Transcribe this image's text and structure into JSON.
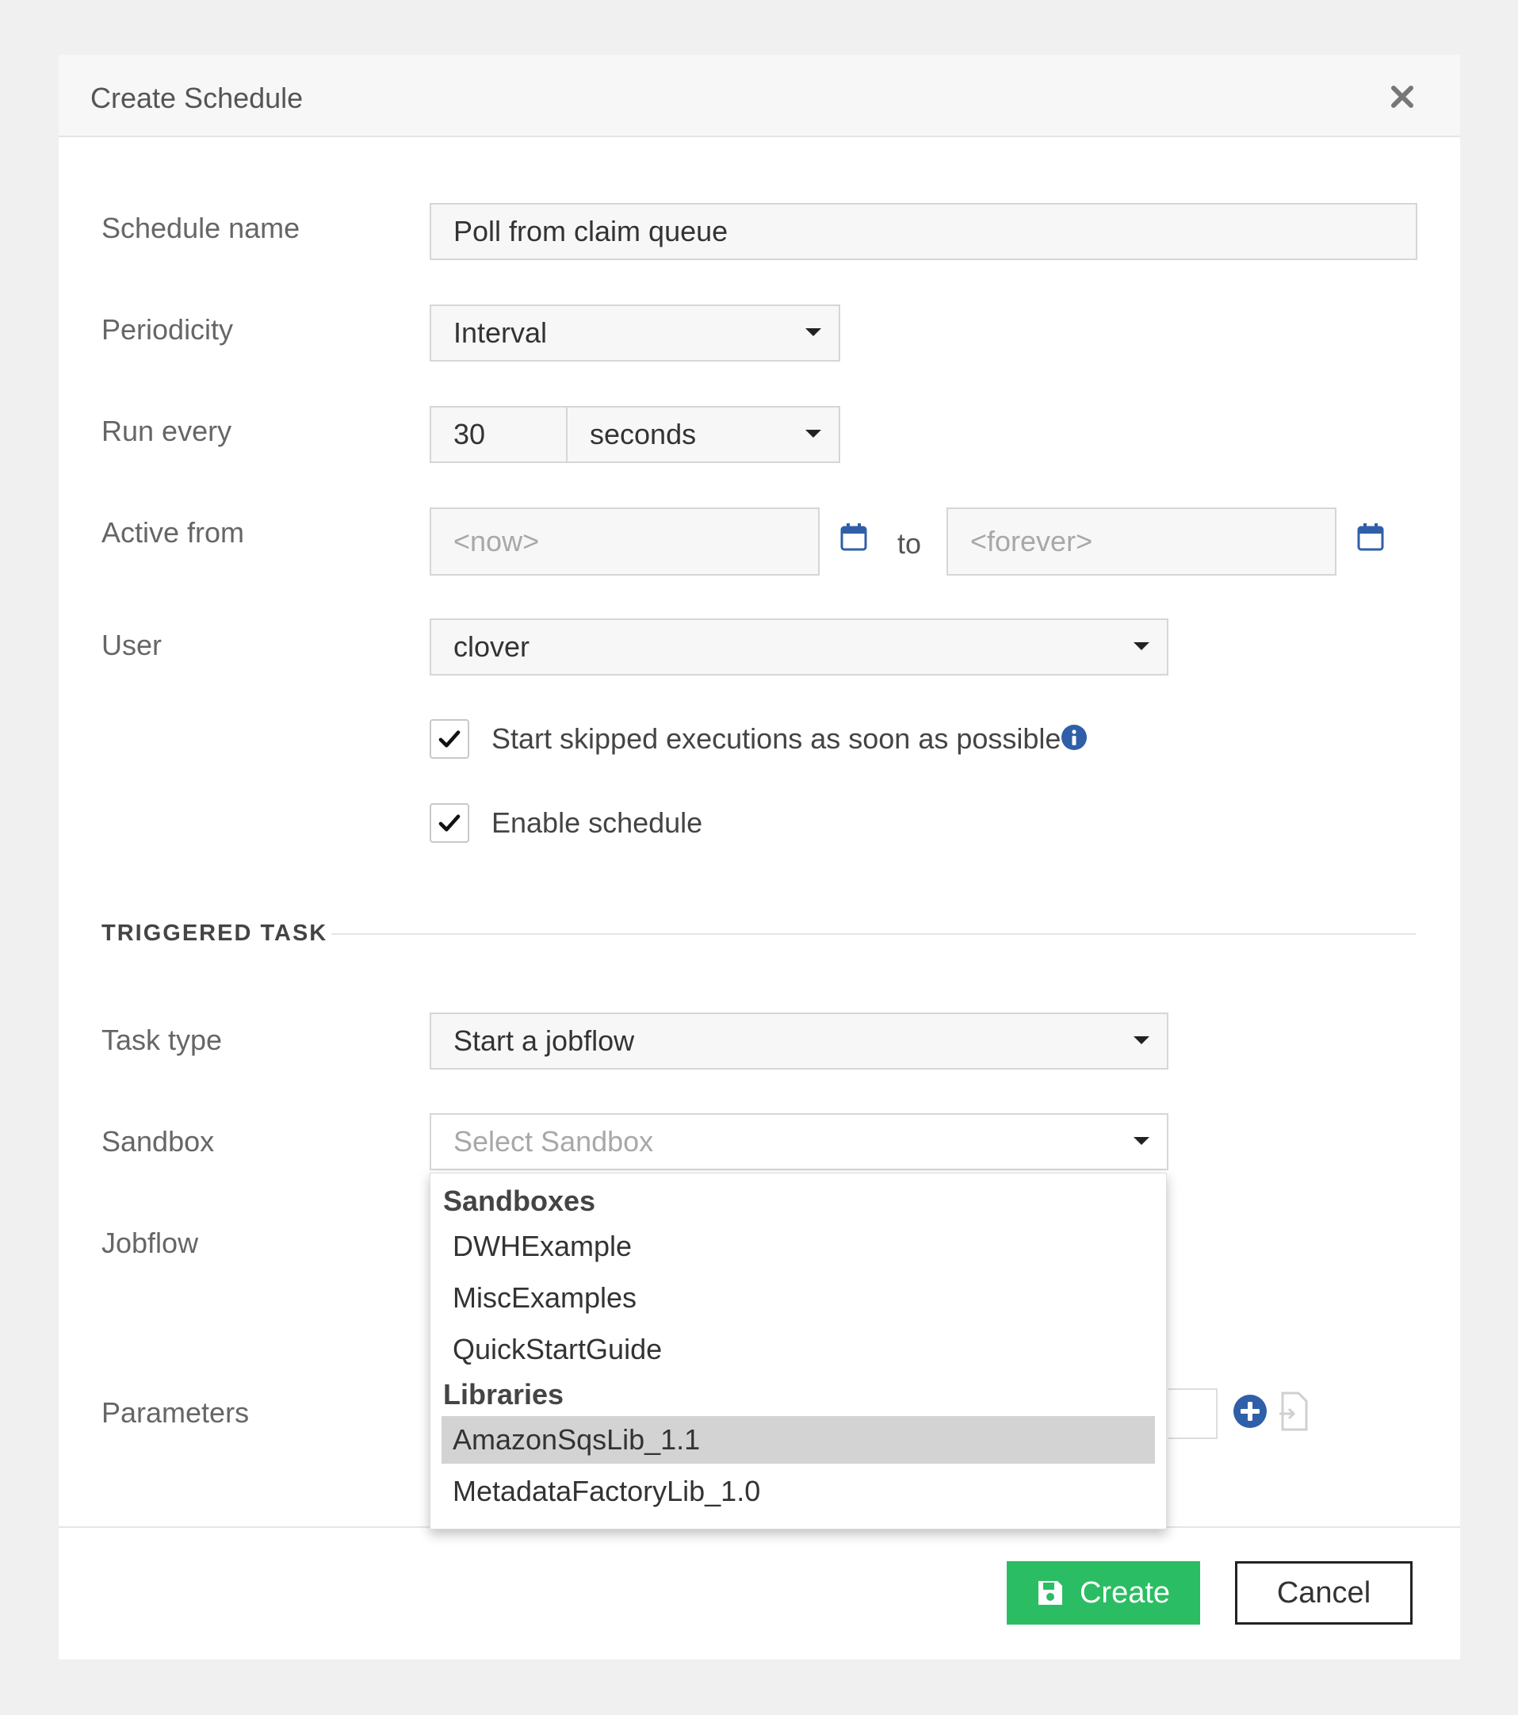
{
  "dialog": {
    "title": "Create Schedule"
  },
  "form": {
    "schedule_name": {
      "label": "Schedule name",
      "value": "Poll from claim queue"
    },
    "periodicity": {
      "label": "Periodicity",
      "value": "Interval"
    },
    "run_every": {
      "label": "Run every",
      "value": "30",
      "unit": "seconds"
    },
    "active_from": {
      "label": "Active from",
      "from_placeholder": "<now>",
      "to_text": "to",
      "to_placeholder": "<forever>"
    },
    "user": {
      "label": "User",
      "value": "clover"
    },
    "start_skipped": {
      "label": "Start skipped executions as soon as possible",
      "checked": true
    },
    "enable_schedule": {
      "label": "Enable schedule",
      "checked": true
    }
  },
  "triggered_task": {
    "section_title": "TRIGGERED TASK",
    "task_type": {
      "label": "Task type",
      "value": "Start a jobflow"
    },
    "sandbox": {
      "label": "Sandbox",
      "placeholder": "Select Sandbox"
    },
    "jobflow": {
      "label": "Jobflow"
    },
    "parameters": {
      "label": "Parameters"
    }
  },
  "sandbox_dropdown": {
    "groups": [
      {
        "label": "Sandboxes",
        "items": [
          "DWHExample",
          "MiscExamples",
          "QuickStartGuide"
        ]
      },
      {
        "label": "Libraries",
        "items": [
          "AmazonSqsLib_1.1",
          "MetadataFactoryLib_1.0"
        ]
      }
    ],
    "highlighted": "AmazonSqsLib_1.1"
  },
  "footer": {
    "create_label": "Create",
    "cancel_label": "Cancel"
  },
  "colors": {
    "accent_blue": "#2f5fa8",
    "create_green": "#2bbd63"
  }
}
